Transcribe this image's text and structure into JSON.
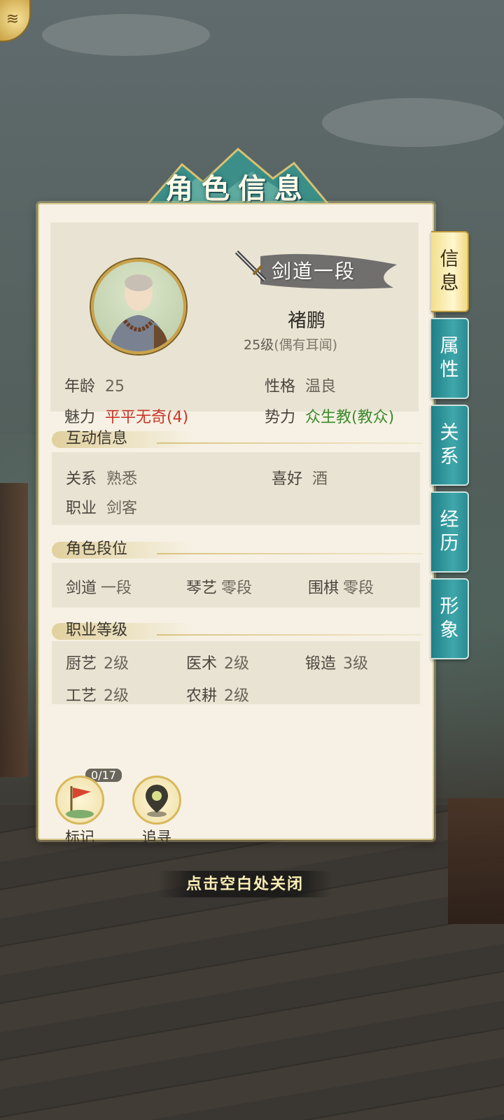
{
  "window": {
    "title": "角色信息",
    "close_hint": "点击空白处关闭"
  },
  "side_tabs": [
    {
      "label_line1": "信",
      "label_line2": "息",
      "active": true
    },
    {
      "label_line1": "属",
      "label_line2": "性",
      "active": false
    },
    {
      "label_line1": "关",
      "label_line2": "系",
      "active": false
    },
    {
      "label_line1": "经",
      "label_line2": "历",
      "active": false
    },
    {
      "label_line1": "形",
      "label_line2": "象",
      "active": false
    }
  ],
  "character": {
    "rank": "剑道一段",
    "name": "褚鹏",
    "level": "25级",
    "level_note": "(偶有耳闻)",
    "age_label": "年龄",
    "age": "25",
    "personality_label": "性格",
    "personality": "温良",
    "charm_label": "魅力",
    "charm": "平平无奇(4)",
    "faction_label": "势力",
    "faction": "众生教(教众)",
    "colors": {
      "charm": "#c8362a",
      "faction": "#3a8a2b"
    }
  },
  "interaction": {
    "title": "互动信息",
    "relation_label": "关系",
    "relation": "熟悉",
    "hobby_label": "喜好",
    "hobby": "酒",
    "job_label": "职业",
    "job": "剑客"
  },
  "ranks": {
    "title": "角色段位",
    "items": [
      {
        "label": "剑道",
        "value": "一段"
      },
      {
        "label": "琴艺",
        "value": "零段"
      },
      {
        "label": "围棋",
        "value": "零段"
      }
    ]
  },
  "professions": {
    "title": "职业等级",
    "items": [
      {
        "label": "厨艺",
        "value": "2级"
      },
      {
        "label": "医术",
        "value": "2级"
      },
      {
        "label": "锻造",
        "value": "3级"
      },
      {
        "label": "工艺",
        "value": "2级"
      },
      {
        "label": "农耕",
        "value": "2级"
      }
    ]
  },
  "actions": {
    "mark_label": "标记",
    "mark_counter": "0/17",
    "track_label": "追寻"
  },
  "icons": [
    "menu-icon",
    "flag-icon",
    "location-pin-icon",
    "sword-icon",
    "avatar-portrait"
  ]
}
